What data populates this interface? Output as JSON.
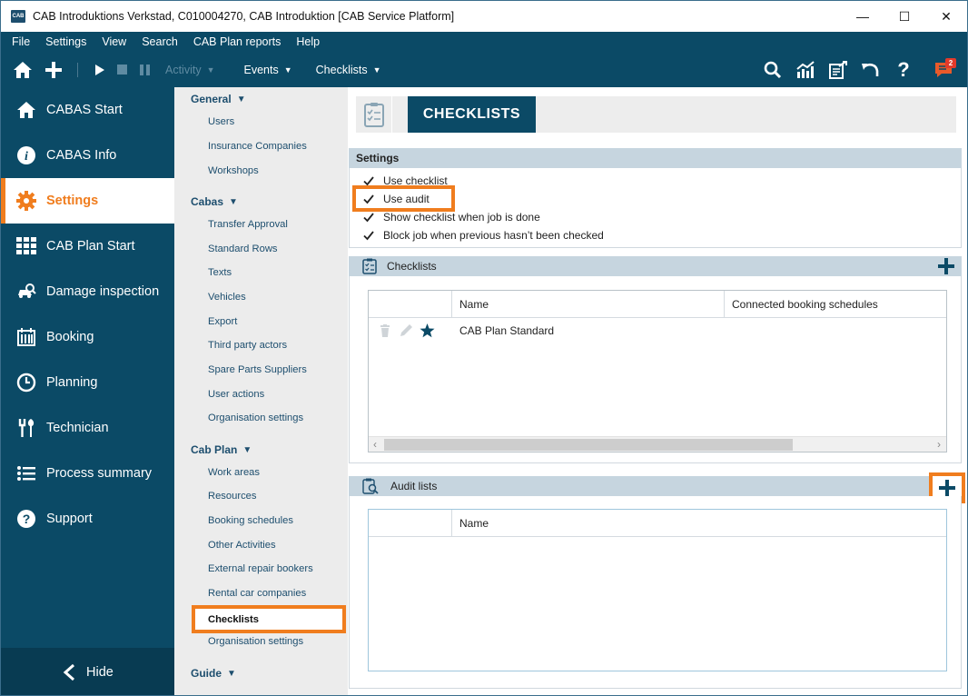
{
  "window": {
    "title": "CAB Introduktions Verkstad, C010004270, CAB Introduktion [CAB Service Platform]",
    "app_icon": "CAB",
    "controls": {
      "minimize": "—",
      "maximize": "☐",
      "close": "✕"
    }
  },
  "menu": [
    "File",
    "Settings",
    "View",
    "Search",
    "CAB Plan reports",
    "Help"
  ],
  "toolbar": {
    "activity_label": "Activity",
    "events_label": "Events",
    "checklists_label": "Checklists",
    "notification_count": "2"
  },
  "nav": {
    "items": [
      {
        "label": "CABAS Start",
        "icon": "home-icon"
      },
      {
        "label": "CABAS Info",
        "icon": "info-icon"
      },
      {
        "label": "Settings",
        "icon": "gear-icon",
        "active": true
      },
      {
        "label": "CAB Plan Start",
        "icon": "grid-icon"
      },
      {
        "label": "Damage inspection",
        "icon": "car-inspect-icon"
      },
      {
        "label": "Booking",
        "icon": "calendar-icon"
      },
      {
        "label": "Planning",
        "icon": "clock-icon"
      },
      {
        "label": "Technician",
        "icon": "tools-icon"
      },
      {
        "label": "Process summary",
        "icon": "list-icon"
      },
      {
        "label": "Support",
        "icon": "help-icon"
      }
    ],
    "hide_label": "Hide"
  },
  "tree": {
    "groups": [
      {
        "label": "General",
        "items": [
          "Users",
          "Insurance Companies",
          "Workshops"
        ]
      },
      {
        "label": "Cabas",
        "items": [
          "Transfer Approval",
          "Standard Rows",
          "Texts",
          "Vehicles",
          "Export",
          "Third party actors",
          "Spare Parts Suppliers",
          "User actions",
          "Organisation settings"
        ]
      },
      {
        "label": "Cab Plan",
        "items": [
          "Work areas",
          "Resources",
          "Booking schedules",
          "Other Activities",
          "External repair bookers",
          "Rental car companies",
          "Checklists",
          "Organisation settings"
        ]
      },
      {
        "label": "Guide",
        "items": []
      }
    ],
    "selected": "Checklists"
  },
  "main": {
    "header_title": "CHECKLISTS",
    "settings": {
      "title": "Settings",
      "options": [
        {
          "label": "Use checklist",
          "checked": true
        },
        {
          "label": "Use audit",
          "checked": true
        },
        {
          "label": "Show checklist when job is done",
          "checked": true
        },
        {
          "label": "Block job when previous hasn’t been checked",
          "checked": true
        }
      ]
    },
    "checklists": {
      "title": "Checklists",
      "columns": [
        "Name",
        "Connected booking schedules"
      ],
      "rows": [
        {
          "name": "CAB Plan Standard",
          "schedules": ""
        }
      ],
      "scroll_left": "‹",
      "scroll_right": "›"
    },
    "audit_lists": {
      "title": "Audit lists",
      "columns": [
        "Name"
      ]
    }
  }
}
